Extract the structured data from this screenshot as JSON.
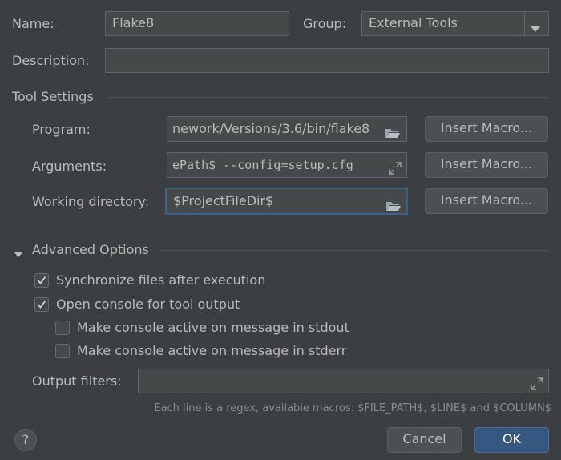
{
  "header": {
    "name_label": "Name:",
    "name_value": "Flake8",
    "group_label": "Group:",
    "group_value": "External Tools",
    "description_label": "Description:",
    "description_value": ""
  },
  "tool_settings": {
    "title": "Tool Settings",
    "program_label": "Program:",
    "program_value": "nework/Versions/3.6/bin/flake8",
    "arguments_label": "Arguments:",
    "arguments_value": "ePath$  --config=setup.cfg",
    "working_dir_label": "Working directory:",
    "working_dir_value": "$ProjectFileDir$",
    "insert_macro_label": "Insert Macro..."
  },
  "advanced": {
    "title": "Advanced Options",
    "options": [
      {
        "label": "Synchronize files after execution",
        "checked": true
      },
      {
        "label": "Open console for tool output",
        "checked": true
      },
      {
        "label": "Make console active on message in stdout",
        "checked": false
      },
      {
        "label": "Make console active on message in stderr",
        "checked": false
      }
    ],
    "output_filters_label": "Output filters:",
    "output_filters_value": "",
    "hint": "Each line is a regex, available macros: $FILE_PATH$, $LINE$ and $COLUMN$"
  },
  "footer": {
    "help_label": "?",
    "cancel_label": "Cancel",
    "ok_label": "OK"
  },
  "colors": {
    "background": "#3c3f41",
    "field": "#45494a",
    "focus_border": "#3d6185",
    "default_button": "#365880",
    "text": "#bbbbbb"
  }
}
